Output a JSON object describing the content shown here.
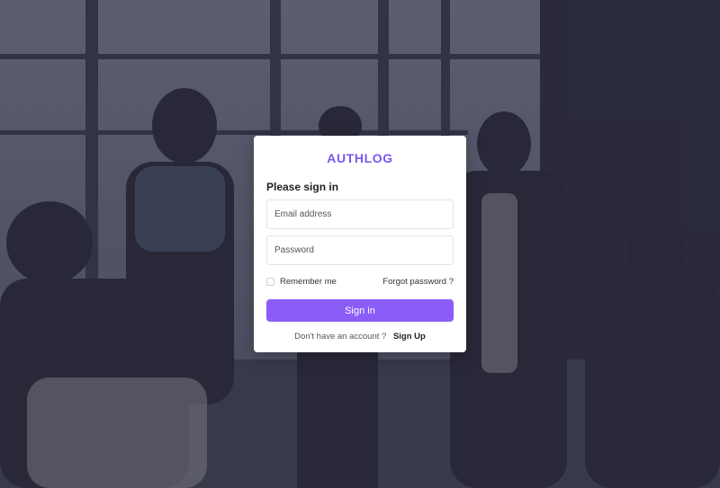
{
  "brand": {
    "name": "AUTHLOG",
    "accent_color": "#8b5cf6"
  },
  "login": {
    "heading": "Please sign in",
    "email_placeholder": "Email address",
    "password_placeholder": "Password",
    "remember_label": "Remember me",
    "forgot_label": "Forgot password ?",
    "submit_label": "Sign in",
    "no_account_text": "Don't have an account ?",
    "signup_label": "Sign Up"
  },
  "background": {
    "description_icon": "office-team-photo",
    "overlay_color": "#28263e"
  }
}
